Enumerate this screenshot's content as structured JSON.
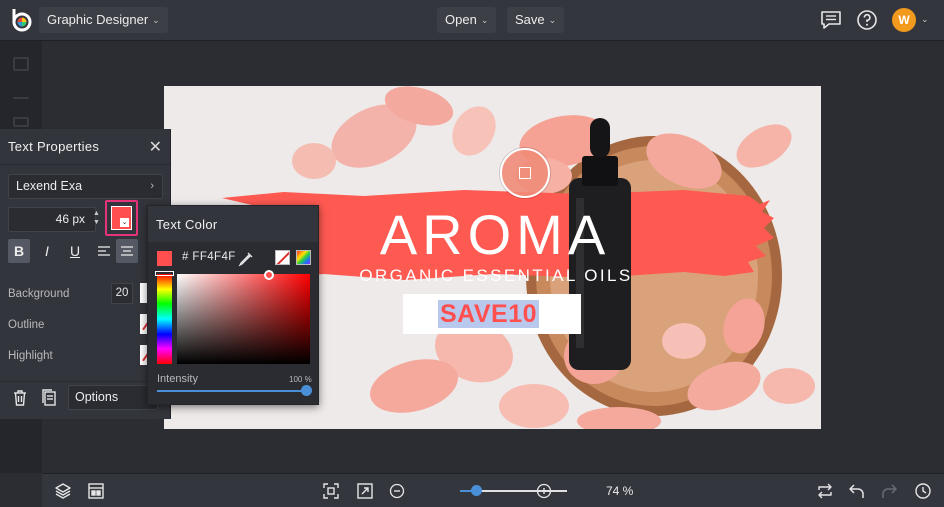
{
  "app": {
    "workspace_label": "Graphic Designer",
    "menu": {
      "open_label": "Open",
      "save_label": "Save"
    },
    "user_initial": "W"
  },
  "design": {
    "title": "AROMA",
    "subtitle": "ORGANIC ESSENTIAL OILS",
    "promo_code": "SAVE10"
  },
  "text_properties": {
    "title": "Text Properties",
    "font_family": "Lexend Exa",
    "font_size": "46 px",
    "text_color": "#FF4F4F",
    "background_label": "Background",
    "background_value": "20",
    "outline_label": "Outline",
    "highlight_label": "Highlight",
    "options_label": "Options"
  },
  "text_color_picker": {
    "title": "Text Color",
    "hex_prefix": "#",
    "hex_value": "FF4F4F",
    "intensity_label": "Intensity",
    "intensity_value": "100 %",
    "intensity_fraction": 1.0
  },
  "bottom_bar": {
    "zoom_text": "74 %",
    "zoom_fraction": 0.15
  },
  "colors": {
    "accent": "#4a90d9",
    "brand_stroke": "#ff5a52",
    "highlight_pink": "#e6337a",
    "avatar": "#f29a1e"
  }
}
